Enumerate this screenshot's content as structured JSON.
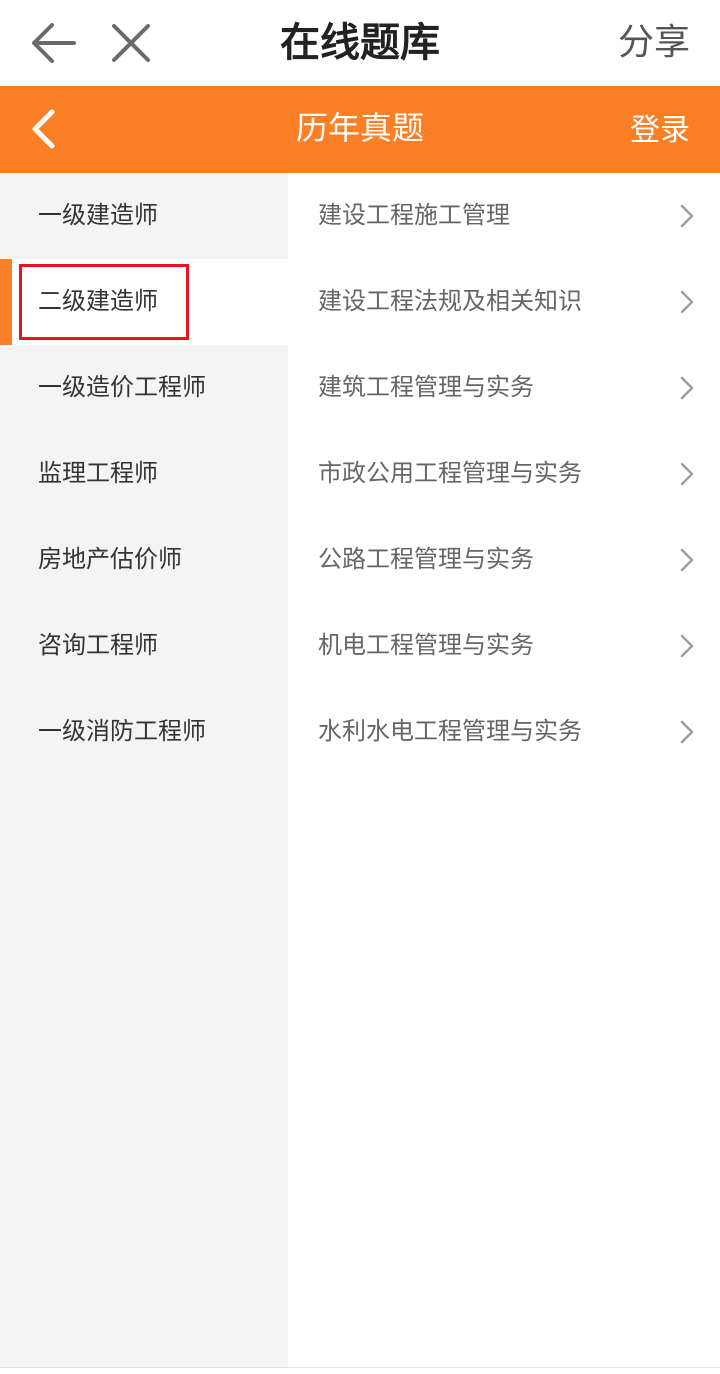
{
  "topbar": {
    "title": "在线题库",
    "share_label": "分享",
    "back_icon": "arrow-left-icon",
    "close_icon": "close-icon"
  },
  "header": {
    "title": "历年真题",
    "login_label": "登录",
    "back_icon": "chevron-left-icon",
    "background_color": "#fb7f24"
  },
  "sidebar": {
    "active_index": 1,
    "items": [
      {
        "label": "一级建造师"
      },
      {
        "label": "二级建造师"
      },
      {
        "label": "一级造价工程师"
      },
      {
        "label": "监理工程师"
      },
      {
        "label": "房地产估价师"
      },
      {
        "label": "咨询工程师"
      },
      {
        "label": "一级消防工程师"
      }
    ]
  },
  "subjects": {
    "items": [
      {
        "label": "建设工程施工管理"
      },
      {
        "label": "建设工程法规及相关知识"
      },
      {
        "label": "建筑工程管理与实务"
      },
      {
        "label": "市政公用工程管理与实务"
      },
      {
        "label": "公路工程管理与实务"
      },
      {
        "label": "机电工程管理与实务"
      },
      {
        "label": "水利水电工程管理与实务"
      }
    ]
  }
}
